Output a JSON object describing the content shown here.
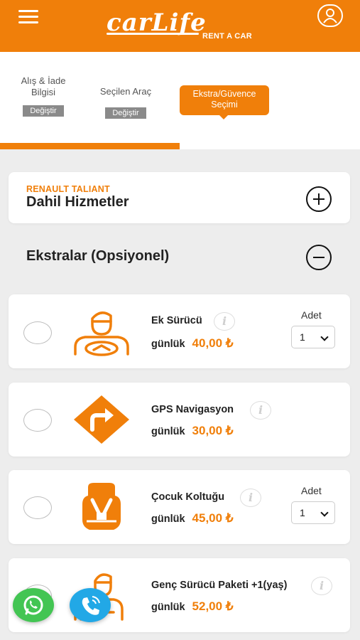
{
  "header": {
    "brand": "carLife",
    "brand_sub": "RENT A CAR",
    "menu_icon": "hamburger-icon",
    "user_icon": "user-icon",
    "accent": "#f07f0a"
  },
  "steps": {
    "items": [
      {
        "label_line1": "Alış & İade",
        "label_line2": "Bilgisi",
        "button": "Değiştir"
      },
      {
        "label_line1": "Seçilen Araç",
        "label_line2": "",
        "button": "Değiştir"
      }
    ],
    "active": {
      "line1": "Ekstra/Güvence",
      "line2": "Seçimi"
    },
    "progress": 0.5
  },
  "included": {
    "car": "RENAULT TALIANT",
    "title": "Dahil Hizmetler",
    "toggle_icon": "plus-circle-icon"
  },
  "extras": {
    "title": "Ekstralar (Opsiyonel)",
    "toggle_icon": "minus-circle-icon",
    "per_label": "günlük",
    "qty_label": "Adet",
    "items": [
      {
        "name": "Ek Sürücü",
        "price": "40,00 ₺",
        "icon": "driver-icon",
        "has_qty": true,
        "qty": "1"
      },
      {
        "name": "GPS Navigasyon",
        "price": "30,00 ₺",
        "icon": "gps-direction-icon",
        "has_qty": false,
        "qty": ""
      },
      {
        "name": "Çocuk Koltuğu",
        "price": "45,00 ₺",
        "icon": "child-seat-icon",
        "has_qty": true,
        "qty": "1"
      },
      {
        "name": "Genç Sürücü Paketi +1(yaş)",
        "price": "52,00 ₺",
        "icon": "young-driver-icon",
        "has_qty": false,
        "qty": ""
      }
    ]
  },
  "fabs": {
    "whatsapp_icon": "whatsapp-icon",
    "phone_icon": "phone-icon",
    "whatsapp_color": "#43c553",
    "phone_color": "#22a8e6"
  }
}
